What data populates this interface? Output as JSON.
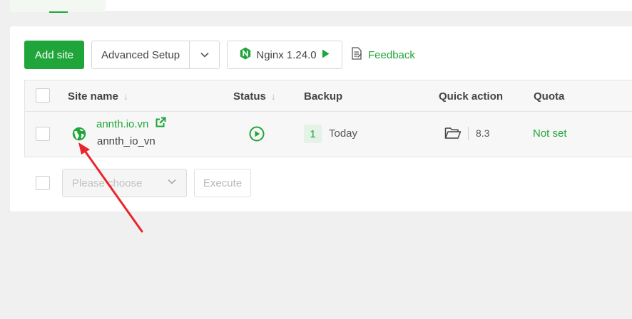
{
  "toolbar": {
    "add_site_label": "Add site",
    "advanced_setup_label": "Advanced Setup",
    "nginx_label": "Nginx 1.24.0",
    "feedback_label": "Feedback"
  },
  "table": {
    "columns": [
      {
        "label": "Site name"
      },
      {
        "label": "Status"
      },
      {
        "label": "Backup"
      },
      {
        "label": "Quick action"
      },
      {
        "label": "Quota"
      }
    ],
    "rows": [
      {
        "site_name": "annth.io.vn",
        "site_subname": "annth_io_vn",
        "backup_count": "1",
        "backup_label": "Today",
        "php_version": "8.3",
        "quota": "Not set"
      }
    ]
  },
  "batch": {
    "select_placeholder": "Please choose",
    "execute_label": "Execute"
  },
  "colors": {
    "accent": "#20a53a",
    "annotation_arrow": "#e8262c"
  },
  "icons": [
    "external-link-icon",
    "globe-icon",
    "play-circle-icon",
    "folder-open-icon",
    "feedback-icon",
    "nginx-logo-icon",
    "play-icon",
    "sort-arrow-icon",
    "chevron-down-icon"
  ]
}
